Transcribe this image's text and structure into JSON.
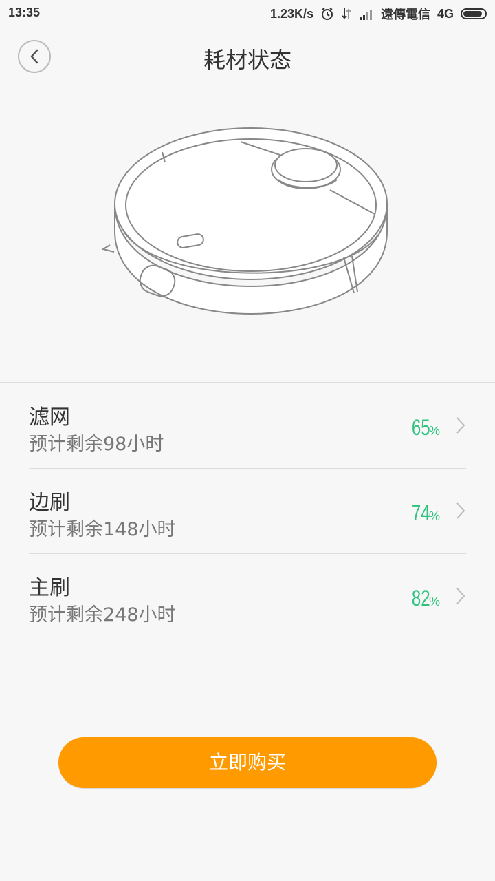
{
  "status_bar": {
    "time": "13:35",
    "network_speed": "1.23K/s",
    "carrier": "遠傳電信",
    "network_type": "4G",
    "icons": [
      "alarm-icon",
      "data-arrows-icon",
      "signal-icon",
      "battery-icon"
    ]
  },
  "header": {
    "title": "耗材状态",
    "back_icon": "chevron-left-icon"
  },
  "consumables": [
    {
      "name": "滤网",
      "remaining": "预计剩余98小时",
      "percent_value": "65",
      "percent_sign": "%"
    },
    {
      "name": "边刷",
      "remaining": "预计剩余148小时",
      "percent_value": "74",
      "percent_sign": "%"
    },
    {
      "name": "主刷",
      "remaining": "预计剩余248小时",
      "percent_value": "82",
      "percent_sign": "%"
    }
  ],
  "buy_button": {
    "label": "立即购买"
  },
  "colors": {
    "accent_orange": "#ff9a00",
    "percent_green": "#2fc27f",
    "background": "#f7f7f7"
  }
}
